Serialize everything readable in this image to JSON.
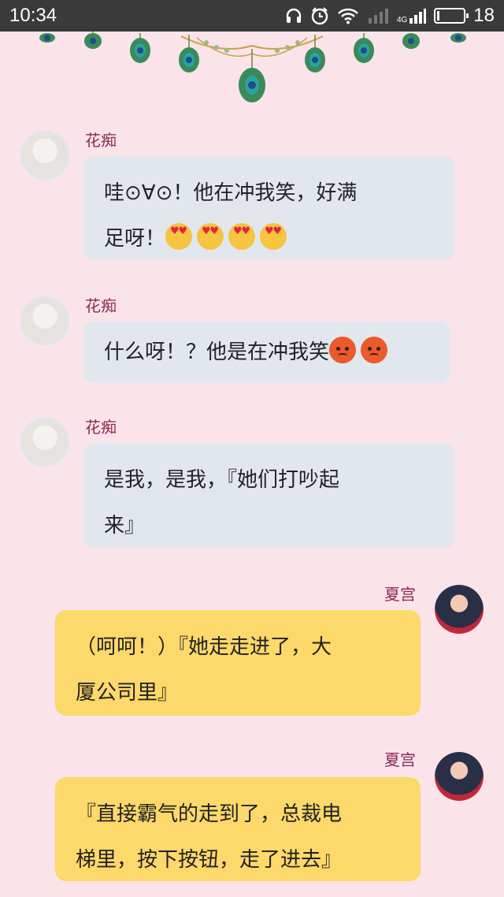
{
  "status_bar": {
    "time": "10:34",
    "network": "4G",
    "battery": "18",
    "battery_level": 0.18,
    "icons": [
      "headset-icon",
      "alarm-icon",
      "wifi-icon",
      "signal-icon",
      "signal-4g-icon",
      "battery-icon"
    ]
  },
  "decoration": {
    "icons": [
      "peacock-feather-icon",
      "flower-garland-icon"
    ]
  },
  "messages": [
    {
      "side": "left",
      "sender": "花痴",
      "line1": "哇⊙∀⊙！他在冲我笑，好满",
      "line2": "足呀！",
      "emoji": [
        "heart-eyes-emoji",
        "heart-eyes-emoji",
        "heart-eyes-emoji",
        "heart-eyes-emoji"
      ]
    },
    {
      "side": "left",
      "sender": "花痴",
      "line1": "什么呀！？他是在冲我笑",
      "emoji": [
        "angry-emoji",
        "angry-emoji"
      ]
    },
    {
      "side": "left",
      "sender": "花痴",
      "line1": "是我，是我，『她们打吵起",
      "line2": "来』"
    },
    {
      "side": "right",
      "sender": "夏宫",
      "line1": "（呵呵！）『她走走进了，大",
      "line2": "厦公司里』"
    },
    {
      "side": "right",
      "sender": "夏宫",
      "line1": "『直接霸气的走到了，总裁电",
      "line2": "梯里，按下按钮，走了进去』"
    }
  ],
  "colors": {
    "background": "#fbe3ea",
    "left_bubble": "#e2e7ee",
    "right_bubble": "#fdd86a",
    "sender_name": "#8a2a55"
  }
}
